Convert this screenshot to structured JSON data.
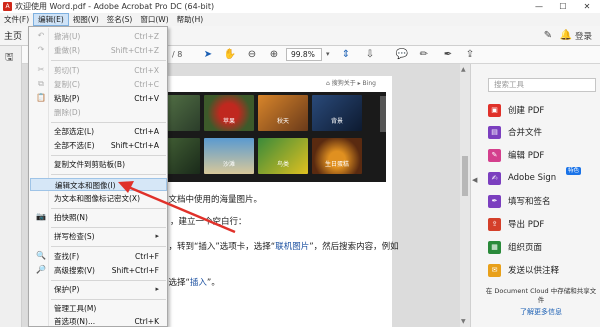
{
  "window": {
    "title": "欢迎使用 Word.pdf - Adobe Acrobat Pro DC (64-bit)",
    "minimize": "—",
    "maximize": "☐",
    "close": "✕"
  },
  "menubar": {
    "items": [
      "文件(F)",
      "编辑(E)",
      "视图(V)",
      "签名(S)",
      "窗口(W)",
      "帮助(H)"
    ]
  },
  "toolbar": {
    "home_tab": "主页",
    "signin": "登录",
    "page_indicator": "/ 8",
    "zoom": "99.8%"
  },
  "edit_menu": {
    "items": [
      {
        "label": "撤消(U)",
        "shortcut": "Ctrl+Z",
        "icon": "undo-icon",
        "glyph": "↶",
        "disabled": true
      },
      {
        "label": "重做(R)",
        "shortcut": "Shift+Ctrl+Z",
        "icon": "redo-icon",
        "glyph": "↷",
        "disabled": true
      },
      {
        "label": "剪切(T)",
        "shortcut": "Ctrl+X",
        "icon": "scissors-icon",
        "glyph": "✂",
        "disabled": true
      },
      {
        "label": "复制(C)",
        "shortcut": "Ctrl+C",
        "icon": "copy-icon",
        "glyph": "⧉",
        "disabled": true
      },
      {
        "label": "粘贴(P)",
        "shortcut": "Ctrl+V",
        "icon": "paste-icon",
        "glyph": "📋",
        "disabled": false
      },
      {
        "label": "删除(D)",
        "shortcut": "",
        "icon": "",
        "glyph": "",
        "disabled": true
      },
      {
        "label": "全部选定(L)",
        "shortcut": "Ctrl+A",
        "icon": "",
        "glyph": "",
        "disabled": false
      },
      {
        "label": "全部不选(E)",
        "shortcut": "Shift+Ctrl+A",
        "icon": "",
        "glyph": "",
        "disabled": false
      },
      {
        "label": "复制文件到剪贴板(B)",
        "shortcut": "",
        "icon": "",
        "glyph": "",
        "disabled": false
      },
      {
        "label": "编辑文本和图像(I)",
        "shortcut": "",
        "icon": "",
        "glyph": "",
        "disabled": false
      },
      {
        "label": "为文本和图像标记密文(X)",
        "shortcut": "",
        "icon": "",
        "glyph": "",
        "disabled": false
      },
      {
        "label": "拍快照(N)",
        "shortcut": "",
        "icon": "camera-icon",
        "glyph": "📷",
        "disabled": false
      },
      {
        "label": "拼写检查(S)",
        "shortcut": "",
        "icon": "",
        "glyph": "",
        "disabled": false
      },
      {
        "label": "查找(F)",
        "shortcut": "Ctrl+F",
        "icon": "search-icon",
        "glyph": "🔍",
        "disabled": false
      },
      {
        "label": "高级搜索(V)",
        "shortcut": "Shift+Ctrl+F",
        "icon": "advanced-search-icon",
        "glyph": "🔎",
        "disabled": false
      },
      {
        "label": "保护(P)",
        "shortcut": "",
        "icon": "",
        "glyph": "",
        "disabled": false
      },
      {
        "label": "管理工具(M)",
        "shortcut": "",
        "icon": "",
        "glyph": "",
        "disabled": false
      },
      {
        "label": "首选项(N)...",
        "shortcut": "Ctrl+K",
        "icon": "",
        "glyph": "",
        "disabled": false
      }
    ]
  },
  "document": {
    "bing_tag": "⌂ 搜狗关于 ▸ Bing",
    "image_captions": [
      "",
      "苹果",
      "秋天",
      "背景",
      "",
      "沙滩",
      "鸟类",
      "生日蛋糕"
    ],
    "lines": [
      {
        "text": "在文档中使用的海量图片。"
      },
      {
        "text": "，建立一个空白行："
      },
      {
        "text_before": "处，转到“插入”选项卡，选择“",
        "link": "联机图片",
        "text_after": "”，然后搜索内容，例如"
      },
      {
        "text_before": "后选择“",
        "link": "插入",
        "text_after": "”。"
      }
    ]
  },
  "right_panel": {
    "search_placeholder": "搜索工具",
    "tools": [
      {
        "label": "创建 PDF",
        "icon": "create-pdf-icon",
        "color": "#e0312a"
      },
      {
        "label": "合并文件",
        "icon": "combine-files-icon",
        "color": "#7b3fbf"
      },
      {
        "label": "编辑 PDF",
        "icon": "edit-pdf-icon",
        "color": "#d43f8d"
      },
      {
        "label": "Adobe Sign",
        "icon": "adobe-sign-icon",
        "color": "#7b3fbf"
      },
      {
        "label": "填写和签名",
        "icon": "fill-sign-icon",
        "color": "#7b3fbf"
      },
      {
        "label": "导出 PDF",
        "icon": "export-pdf-icon",
        "color": "#d43f2a"
      },
      {
        "label": "组织页面",
        "icon": "organize-pages-icon",
        "color": "#2a8a3a"
      },
      {
        "label": "发送以供注释",
        "icon": "send-comments-icon",
        "color": "#e8a01a"
      }
    ],
    "badge": "特色",
    "promo_text": "在 Document Cloud 中存储和共享文件",
    "promo_link": "了解更多信息"
  },
  "colors": {
    "accent": "#1a5fb4",
    "arrow": "#e0312a"
  }
}
